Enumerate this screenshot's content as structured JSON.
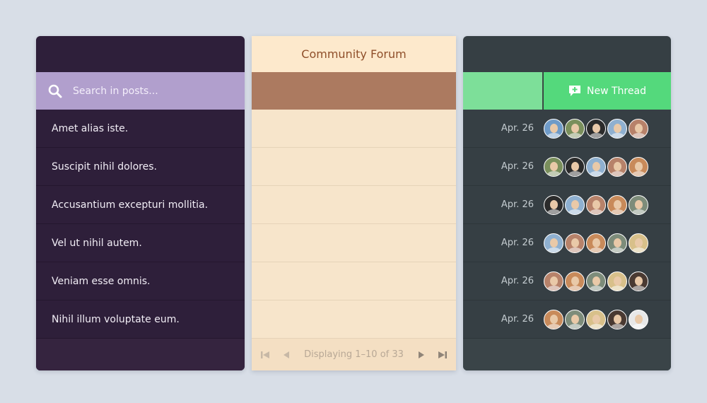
{
  "search": {
    "placeholder": "Search in posts..."
  },
  "posts": [
    {
      "title": "Amet alias iste."
    },
    {
      "title": "Suscipit nihil dolores."
    },
    {
      "title": "Accusantium excepturi mollitia."
    },
    {
      "title": "Vel ut nihil autem."
    },
    {
      "title": "Veniam esse omnis."
    },
    {
      "title": "Nihil illum voluptate eum."
    }
  ],
  "forum": {
    "title": "Community Forum",
    "pagination_text": "Displaying 1–10 of 33"
  },
  "actions": {
    "new_thread_label": "New Thread"
  },
  "threads": [
    {
      "date": "Apr. 26",
      "avatars": [
        "#6f9bc8",
        "#7a8f5c",
        "#2b2b2b",
        "#8fb0d0",
        "#b7826a"
      ]
    },
    {
      "date": "Apr. 26",
      "avatars": [
        "#7a8f5c",
        "#2b2b2b",
        "#8fb0d0",
        "#b7826a",
        "#c88a5a"
      ]
    },
    {
      "date": "Apr. 26",
      "avatars": [
        "#2b2b2b",
        "#8fb0d0",
        "#b7826a",
        "#c88a5a",
        "#7d8c7a"
      ]
    },
    {
      "date": "Apr. 26",
      "avatars": [
        "#8fb0d0",
        "#b7826a",
        "#c88a5a",
        "#7d8c7a",
        "#d8c08a"
      ]
    },
    {
      "date": "Apr. 26",
      "avatars": [
        "#b7826a",
        "#c88a5a",
        "#7d8c7a",
        "#d8c08a",
        "#4a3a32"
      ]
    },
    {
      "date": "Apr. 26",
      "avatars": [
        "#c88a5a",
        "#7d8c7a",
        "#d8c08a",
        "#4a3a32",
        "#e8e8e8"
      ]
    }
  ],
  "icons": {
    "search": "search-icon",
    "new_thread": "chat-plus-icon",
    "first_page": "skip-back-icon",
    "prev_page": "triangle-left-icon",
    "next_page": "triangle-right-icon",
    "last_page": "skip-forward-icon"
  },
  "colors": {
    "left_panel": "#2e1f3a",
    "search_bar": "#b19fcd",
    "mid_panel": "#f7e5cb",
    "mid_band": "#ac7a60",
    "forum_title": "#8f4f2a",
    "right_panel": "#363f44",
    "new_thread": "#54d97c",
    "right_bar_light": "#7ddf99"
  }
}
